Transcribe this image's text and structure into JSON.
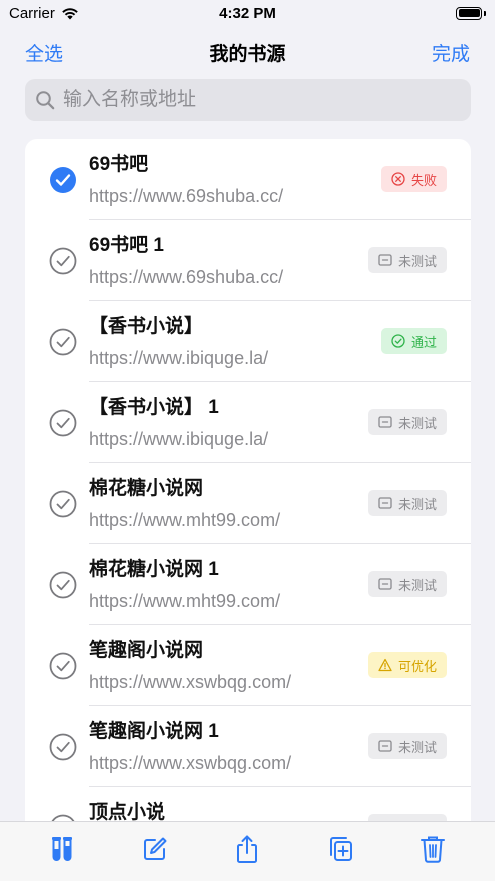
{
  "status_bar": {
    "carrier": "Carrier",
    "time": "4:32 PM"
  },
  "nav": {
    "left_button": "全选",
    "title": "我的书源",
    "right_button": "完成"
  },
  "search": {
    "placeholder": "输入名称或地址",
    "value": ""
  },
  "sources": [
    {
      "name": "69书吧",
      "url": "https://www.69shuba.cc/",
      "selected": true,
      "status": "失败",
      "status_type": "fail"
    },
    {
      "name": "69书吧 1",
      "url": "https://www.69shuba.cc/",
      "selected": false,
      "status": "未测试",
      "status_type": "none"
    },
    {
      "name": "【香书小说】",
      "url": "https://www.ibiquge.la/",
      "selected": false,
      "status": "通过",
      "status_type": "pass"
    },
    {
      "name": "【香书小说】 1",
      "url": "https://www.ibiquge.la/",
      "selected": false,
      "status": "未测试",
      "status_type": "none"
    },
    {
      "name": "棉花糖小说网",
      "url": "https://www.mht99.com/",
      "selected": false,
      "status": "未测试",
      "status_type": "none"
    },
    {
      "name": "棉花糖小说网 1",
      "url": "https://www.mht99.com/",
      "selected": false,
      "status": "未测试",
      "status_type": "none"
    },
    {
      "name": "笔趣阁小说网",
      "url": "https://www.xswbqg.com/",
      "selected": false,
      "status": "可优化",
      "status_type": "warn"
    },
    {
      "name": "笔趣阁小说网 1",
      "url": "https://www.xswbqg.com/",
      "selected": false,
      "status": "未测试",
      "status_type": "none"
    },
    {
      "name": "顶点小说",
      "url": "",
      "selected": false,
      "status": "未测试",
      "status_type": "none"
    }
  ],
  "colors": {
    "accent": "#2f7bf5",
    "fail": "#e64545",
    "pass": "#2fb34a",
    "warn": "#d6a400",
    "neutral": "#8a8a8e"
  },
  "toolbar_icons": [
    "test-tubes-icon",
    "edit-icon",
    "share-icon",
    "add-copy-icon",
    "trash-icon"
  ]
}
